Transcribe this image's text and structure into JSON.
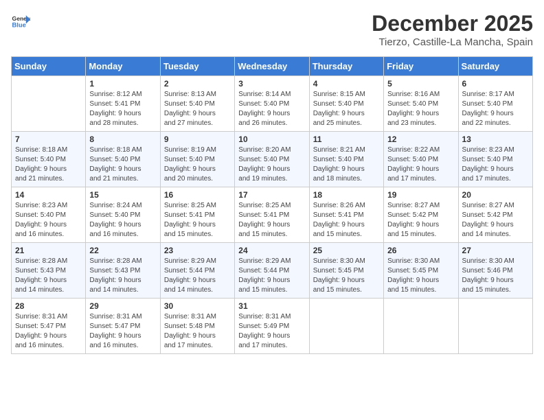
{
  "logo": {
    "line1": "General",
    "line2": "Blue"
  },
  "title": "December 2025",
  "subtitle": "Tierzo, Castille-La Mancha, Spain",
  "headers": [
    "Sunday",
    "Monday",
    "Tuesday",
    "Wednesday",
    "Thursday",
    "Friday",
    "Saturday"
  ],
  "weeks": [
    [
      {
        "num": "",
        "info": ""
      },
      {
        "num": "1",
        "info": "Sunrise: 8:12 AM\nSunset: 5:41 PM\nDaylight: 9 hours\nand 28 minutes."
      },
      {
        "num": "2",
        "info": "Sunrise: 8:13 AM\nSunset: 5:40 PM\nDaylight: 9 hours\nand 27 minutes."
      },
      {
        "num": "3",
        "info": "Sunrise: 8:14 AM\nSunset: 5:40 PM\nDaylight: 9 hours\nand 26 minutes."
      },
      {
        "num": "4",
        "info": "Sunrise: 8:15 AM\nSunset: 5:40 PM\nDaylight: 9 hours\nand 25 minutes."
      },
      {
        "num": "5",
        "info": "Sunrise: 8:16 AM\nSunset: 5:40 PM\nDaylight: 9 hours\nand 23 minutes."
      },
      {
        "num": "6",
        "info": "Sunrise: 8:17 AM\nSunset: 5:40 PM\nDaylight: 9 hours\nand 22 minutes."
      }
    ],
    [
      {
        "num": "7",
        "info": "Sunrise: 8:18 AM\nSunset: 5:40 PM\nDaylight: 9 hours\nand 21 minutes."
      },
      {
        "num": "8",
        "info": "Sunrise: 8:18 AM\nSunset: 5:40 PM\nDaylight: 9 hours\nand 21 minutes."
      },
      {
        "num": "9",
        "info": "Sunrise: 8:19 AM\nSunset: 5:40 PM\nDaylight: 9 hours\nand 20 minutes."
      },
      {
        "num": "10",
        "info": "Sunrise: 8:20 AM\nSunset: 5:40 PM\nDaylight: 9 hours\nand 19 minutes."
      },
      {
        "num": "11",
        "info": "Sunrise: 8:21 AM\nSunset: 5:40 PM\nDaylight: 9 hours\nand 18 minutes."
      },
      {
        "num": "12",
        "info": "Sunrise: 8:22 AM\nSunset: 5:40 PM\nDaylight: 9 hours\nand 17 minutes."
      },
      {
        "num": "13",
        "info": "Sunrise: 8:23 AM\nSunset: 5:40 PM\nDaylight: 9 hours\nand 17 minutes."
      }
    ],
    [
      {
        "num": "14",
        "info": "Sunrise: 8:23 AM\nSunset: 5:40 PM\nDaylight: 9 hours\nand 16 minutes."
      },
      {
        "num": "15",
        "info": "Sunrise: 8:24 AM\nSunset: 5:40 PM\nDaylight: 9 hours\nand 16 minutes."
      },
      {
        "num": "16",
        "info": "Sunrise: 8:25 AM\nSunset: 5:41 PM\nDaylight: 9 hours\nand 15 minutes."
      },
      {
        "num": "17",
        "info": "Sunrise: 8:25 AM\nSunset: 5:41 PM\nDaylight: 9 hours\nand 15 minutes."
      },
      {
        "num": "18",
        "info": "Sunrise: 8:26 AM\nSunset: 5:41 PM\nDaylight: 9 hours\nand 15 minutes."
      },
      {
        "num": "19",
        "info": "Sunrise: 8:27 AM\nSunset: 5:42 PM\nDaylight: 9 hours\nand 15 minutes."
      },
      {
        "num": "20",
        "info": "Sunrise: 8:27 AM\nSunset: 5:42 PM\nDaylight: 9 hours\nand 14 minutes."
      }
    ],
    [
      {
        "num": "21",
        "info": "Sunrise: 8:28 AM\nSunset: 5:43 PM\nDaylight: 9 hours\nand 14 minutes."
      },
      {
        "num": "22",
        "info": "Sunrise: 8:28 AM\nSunset: 5:43 PM\nDaylight: 9 hours\nand 14 minutes."
      },
      {
        "num": "23",
        "info": "Sunrise: 8:29 AM\nSunset: 5:44 PM\nDaylight: 9 hours\nand 14 minutes."
      },
      {
        "num": "24",
        "info": "Sunrise: 8:29 AM\nSunset: 5:44 PM\nDaylight: 9 hours\nand 15 minutes."
      },
      {
        "num": "25",
        "info": "Sunrise: 8:30 AM\nSunset: 5:45 PM\nDaylight: 9 hours\nand 15 minutes."
      },
      {
        "num": "26",
        "info": "Sunrise: 8:30 AM\nSunset: 5:45 PM\nDaylight: 9 hours\nand 15 minutes."
      },
      {
        "num": "27",
        "info": "Sunrise: 8:30 AM\nSunset: 5:46 PM\nDaylight: 9 hours\nand 15 minutes."
      }
    ],
    [
      {
        "num": "28",
        "info": "Sunrise: 8:31 AM\nSunset: 5:47 PM\nDaylight: 9 hours\nand 16 minutes."
      },
      {
        "num": "29",
        "info": "Sunrise: 8:31 AM\nSunset: 5:47 PM\nDaylight: 9 hours\nand 16 minutes."
      },
      {
        "num": "30",
        "info": "Sunrise: 8:31 AM\nSunset: 5:48 PM\nDaylight: 9 hours\nand 17 minutes."
      },
      {
        "num": "31",
        "info": "Sunrise: 8:31 AM\nSunset: 5:49 PM\nDaylight: 9 hours\nand 17 minutes."
      },
      {
        "num": "",
        "info": ""
      },
      {
        "num": "",
        "info": ""
      },
      {
        "num": "",
        "info": ""
      }
    ]
  ]
}
